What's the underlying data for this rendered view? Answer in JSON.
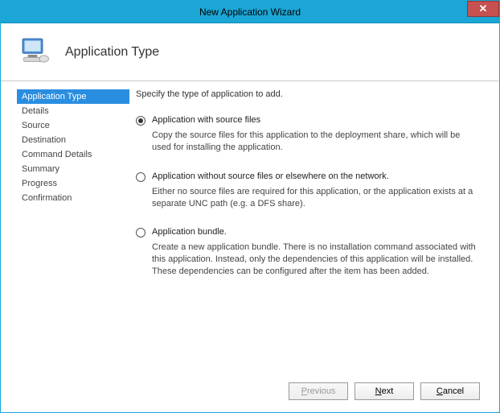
{
  "titlebar": {
    "title": "New Application Wizard"
  },
  "header": {
    "title": "Application Type"
  },
  "sidebar": {
    "items": [
      {
        "label": "Application Type",
        "selected": true
      },
      {
        "label": "Details",
        "selected": false
      },
      {
        "label": "Source",
        "selected": false
      },
      {
        "label": "Destination",
        "selected": false
      },
      {
        "label": "Command Details",
        "selected": false
      },
      {
        "label": "Summary",
        "selected": false
      },
      {
        "label": "Progress",
        "selected": false
      },
      {
        "label": "Confirmation",
        "selected": false
      }
    ]
  },
  "main": {
    "instruction": "Specify the type of application to add.",
    "options": [
      {
        "checked": true,
        "label_pre": "Application with ",
        "label_key": "s",
        "label_post": "ource files",
        "desc": "Copy the source files for this application to the deployment share, which will be used for installing the application."
      },
      {
        "checked": false,
        "label_pre": "Application ",
        "label_key": "w",
        "label_post": "ithout source files or elsewhere on the network.",
        "desc": "Either no source files are required for this application, or the application exists at a separate UNC path (e.g. a DFS share)."
      },
      {
        "checked": false,
        "label_pre": "Application ",
        "label_key": "b",
        "label_post": "undle.",
        "desc": "Create a new application bundle.  There is no installation command associated with this application.  Instead, only the dependencies of this application will be installed.  These dependencies can be configured after the item has been added."
      }
    ]
  },
  "footer": {
    "previous_key": "P",
    "previous_post": "revious",
    "next_pre": "",
    "next_key": "N",
    "next_post": "ext",
    "cancel_pre": "",
    "cancel_key": "C",
    "cancel_post": "ancel"
  }
}
